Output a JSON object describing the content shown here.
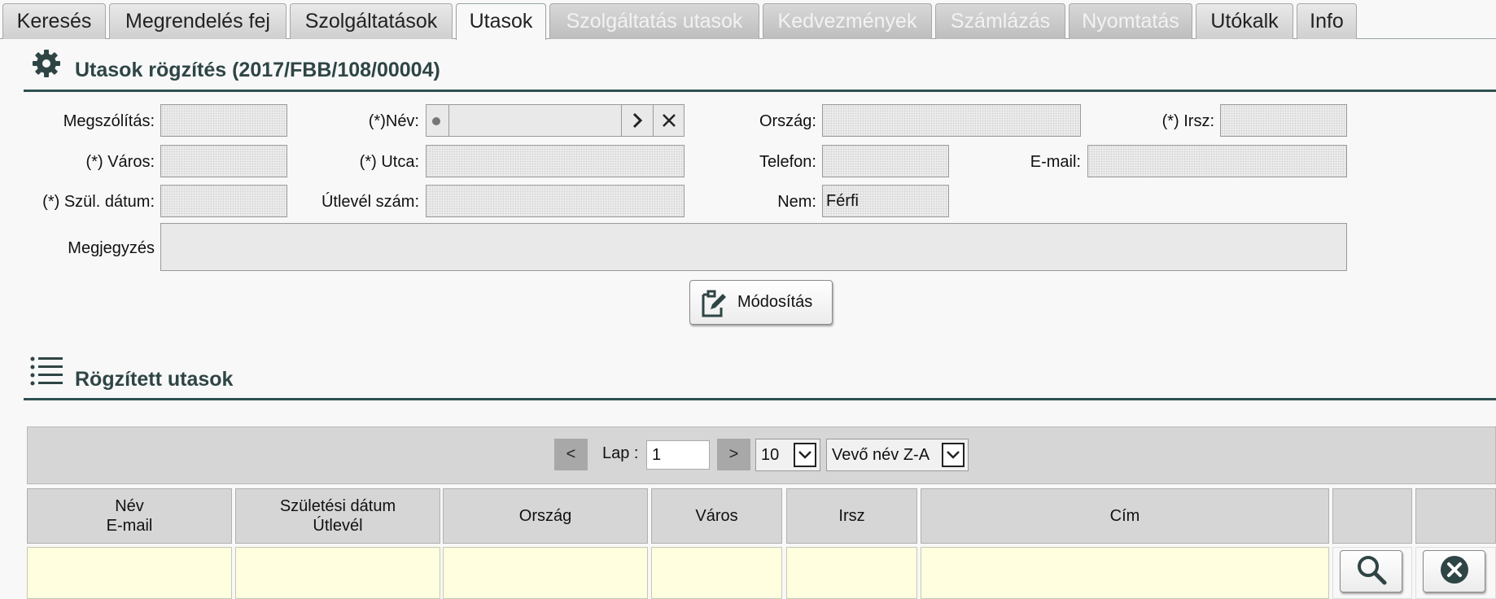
{
  "tabs": [
    {
      "label": "Keresés",
      "state": "normal"
    },
    {
      "label": "Megrendelés fej",
      "state": "normal"
    },
    {
      "label": "Szolgáltatások",
      "state": "normal"
    },
    {
      "label": "Utasok",
      "state": "active"
    },
    {
      "label": "Szolgáltatás utasok",
      "state": "disabled"
    },
    {
      "label": "Kedvezmények",
      "state": "disabled"
    },
    {
      "label": "Számlázás",
      "state": "disabled"
    },
    {
      "label": "Nyomtatás",
      "state": "disabled"
    },
    {
      "label": "Utókalk",
      "state": "normal"
    },
    {
      "label": "Info",
      "state": "normal"
    }
  ],
  "form": {
    "title": "Utasok rögzítés (2017/FBB/108/00004)",
    "header_icon": "gear-icon",
    "fields": {
      "megszolitas": {
        "label": "Megszólítás:",
        "value": ""
      },
      "nev": {
        "label": "(*)Név:",
        "value": ""
      },
      "orszag": {
        "label": "Ország:",
        "value": ""
      },
      "irsz": {
        "label": "(*) Irsz:",
        "value": ""
      },
      "varos": {
        "label": "(*) Város:",
        "value": ""
      },
      "utca": {
        "label": "(*) Utca:",
        "value": ""
      },
      "telefon": {
        "label": "Telefon:",
        "value": ""
      },
      "email": {
        "label": "E-mail:",
        "value": ""
      },
      "szul_datum": {
        "label": "(*) Szül. dátum:",
        "value": ""
      },
      "utlevel": {
        "label": "Útlevél szám:",
        "value": ""
      },
      "nem": {
        "label": "Nem:",
        "value": "Férfi"
      },
      "megjegyzes": {
        "label": "Megjegyzés",
        "value": ""
      }
    },
    "modify_button": "Módosítás"
  },
  "list": {
    "title": "Rögzített utasok",
    "header_icon": "list-icon",
    "pager": {
      "prev": "<",
      "next": ">",
      "page_label": "Lap :",
      "page_value": "1",
      "page_size": "10",
      "sort": "Vevő név Z-A"
    },
    "columns": [
      {
        "line1": "Név",
        "line2": "E-mail"
      },
      {
        "line1": "Születési dátum",
        "line2": "Útlevél"
      },
      {
        "line1": "Ország",
        "line2": ""
      },
      {
        "line1": "Város",
        "line2": ""
      },
      {
        "line1": "Irsz",
        "line2": ""
      },
      {
        "line1": "Cím",
        "line2": ""
      },
      {
        "line1": "",
        "line2": ""
      },
      {
        "line1": "",
        "line2": ""
      }
    ]
  },
  "colors": {
    "accent": "#2f5050",
    "row_highlight": "#ffffe0",
    "header_bg": "#d6d6d6"
  }
}
